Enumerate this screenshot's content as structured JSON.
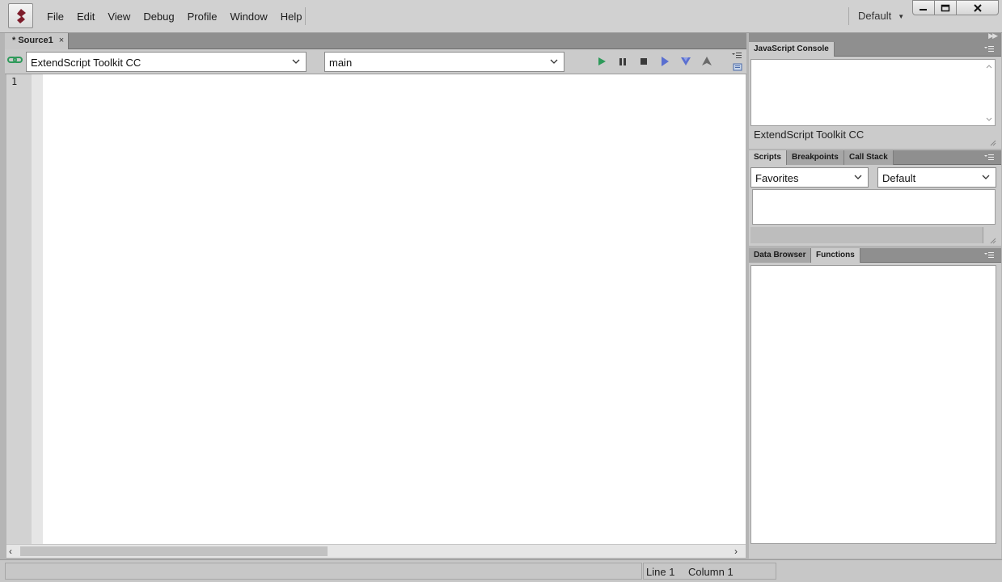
{
  "menu": {
    "items": [
      "File",
      "Edit",
      "View",
      "Debug",
      "Profile",
      "Window",
      "Help"
    ],
    "workspace": "Default"
  },
  "document": {
    "tab_label": "* Source1",
    "tab_close": "×",
    "target_app": "ExtendScript Toolkit CC",
    "engine": "main",
    "line_numbers": [
      "1"
    ]
  },
  "console": {
    "tab_label": "JavaScript Console",
    "target_label": "ExtendScript Toolkit CC"
  },
  "scripts_panel": {
    "tabs": [
      "Scripts",
      "Breakpoints",
      "Call Stack"
    ],
    "location": "Favorites",
    "scope": "Default"
  },
  "data_panel": {
    "tabs": [
      "Data Browser",
      "Functions"
    ]
  },
  "status": {
    "line": "Line 1",
    "column": "Column 1"
  },
  "colors": {
    "run": "#2e9a5a",
    "step": "#5a6fd0",
    "stop": "#3a3a3a",
    "logo": "#7d1c2a"
  }
}
